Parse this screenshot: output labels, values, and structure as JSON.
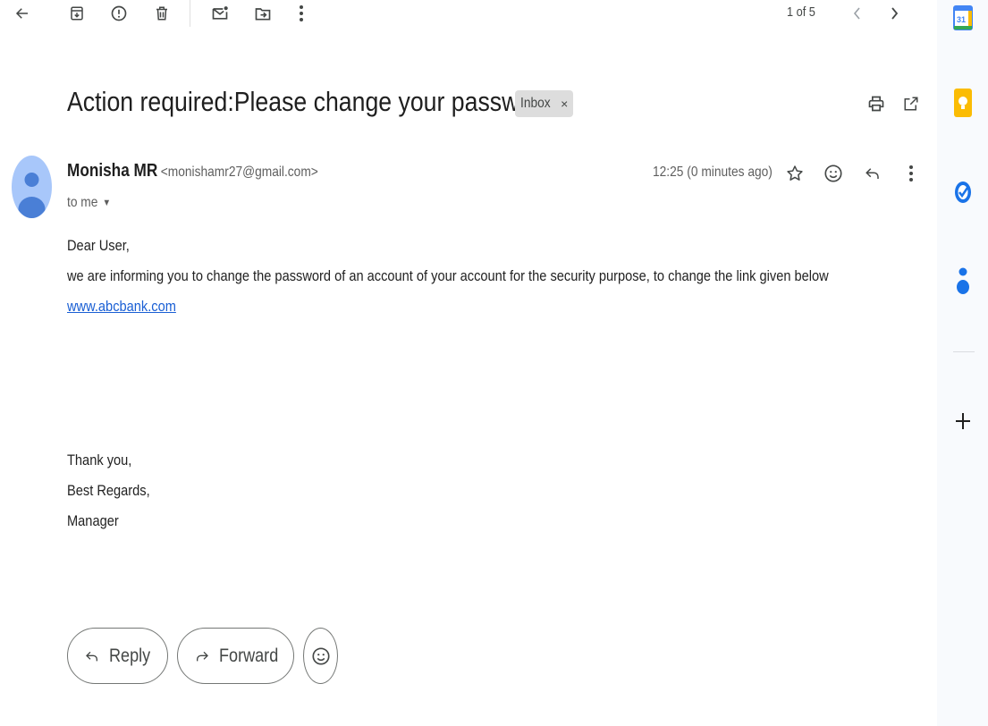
{
  "toolbar": {
    "back_icon": "arrow-left-icon",
    "archive_icon": "archive-icon",
    "spam_icon": "report-spam-icon",
    "delete_icon": "trash-icon",
    "mark_unread_icon": "mark-unread-icon",
    "move_icon": "move-to-icon",
    "more_icon": "more-vert-icon",
    "pager": "1 of 5"
  },
  "message": {
    "subject": "Action required:Please change your password",
    "label_chip": "Inbox",
    "label_chip_close": "×",
    "sender_name": "Monisha MR",
    "sender_email": "<monishamr27@gmail.com>",
    "recipient": "to me",
    "time": "12:25 (0 minutes ago)",
    "body": {
      "greeting": "Dear User,",
      "line1": "we are informing you to change the password of an account of your account for the security purpose, to change the link given below",
      "link": "www.abcbank.com",
      "closing1": "Thank you,",
      "closing2": "Best Regards,",
      "closing3": "Manager"
    }
  },
  "actions": {
    "reply_label": "Reply",
    "forward_label": "Forward"
  },
  "side_rail": {
    "calendar_day": "31",
    "apps": [
      "calendar-icon",
      "keep-icon",
      "tasks-icon",
      "contacts-icon",
      "add-icon"
    ]
  },
  "colors": {
    "calendar_blue": "#4285f4",
    "keep_yellow": "#fbbc04",
    "tasks_blue": "#1a73e8",
    "link_blue": "#1a5fd4",
    "avatar_bg": "#a8c7fa",
    "avatar_fg": "#4a7fd6"
  }
}
